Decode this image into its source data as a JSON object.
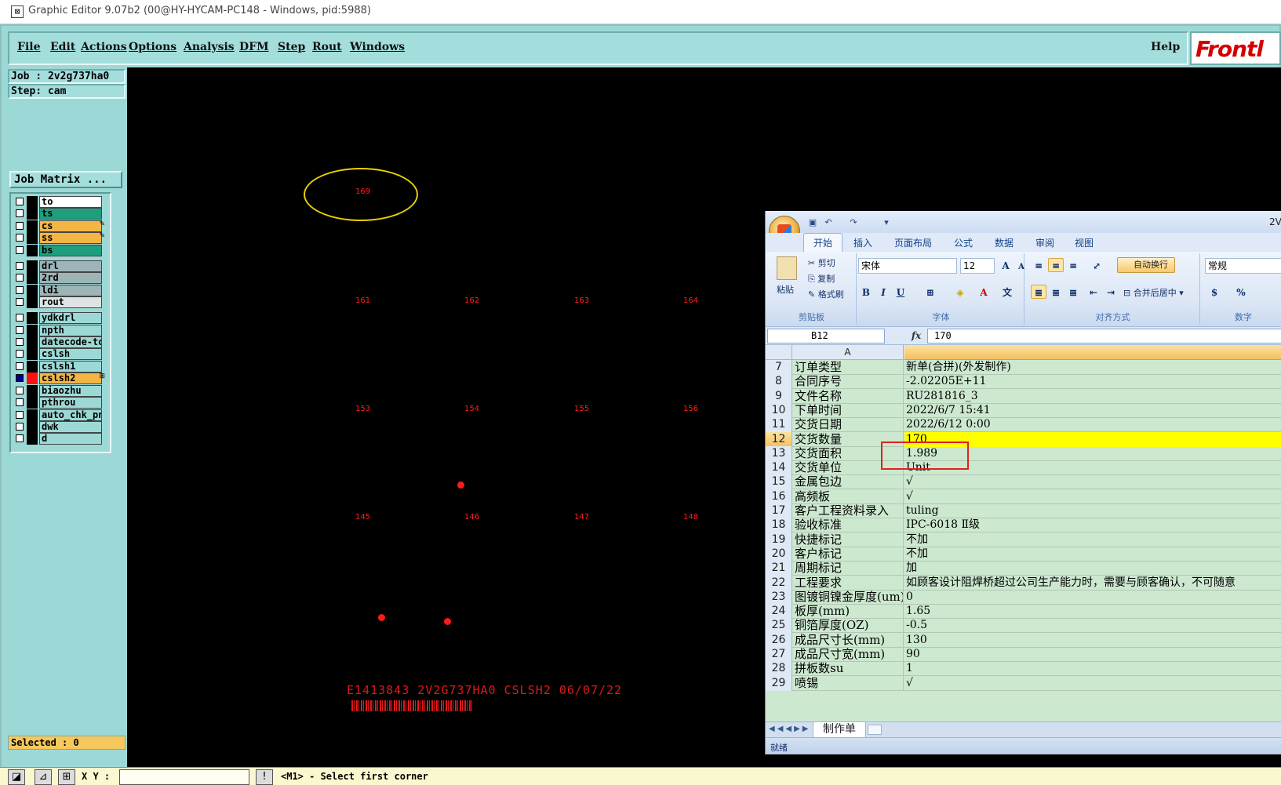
{
  "window": {
    "title": "Graphic Editor 9.07b2 (00@HY-HYCAM-PC148 - Windows, pid:5988)"
  },
  "menubar": {
    "items": [
      "File",
      "Edit",
      "Actions",
      "Options",
      "Analysis",
      "DFM",
      "Step",
      "Rout",
      "Windows"
    ],
    "help": "Help",
    "logo": "Frontl"
  },
  "panel": {
    "job": "Job : 2v2g737ha0",
    "step": "Step: cam",
    "job_matrix": "Job Matrix ...",
    "selected": "Selected : 0"
  },
  "layers": [
    {
      "name": "to",
      "color": "#ffffff",
      "checked": false,
      "active": false
    },
    {
      "name": "ts",
      "color": "#1f9e7e",
      "checked": false,
      "active": false
    },
    {
      "name": "cs",
      "color": "#f5b545",
      "checked": false,
      "active": false,
      "mark": "✎"
    },
    {
      "name": "ss",
      "color": "#f5b545",
      "checked": false,
      "active": false,
      "mark": "✎"
    },
    {
      "name": "bs",
      "color": "#1f9e7e",
      "checked": false,
      "active": false
    },
    {
      "name": "drl",
      "color": "#9eb5b8",
      "checked": false,
      "active": false
    },
    {
      "name": "2rd",
      "color": "#9eb5b8",
      "checked": false,
      "active": false
    },
    {
      "name": "ldi",
      "color": "#9eb5b8",
      "checked": false,
      "active": false
    },
    {
      "name": "rout",
      "color": "#dfe3e3",
      "checked": false,
      "active": false
    },
    {
      "name": "ydkdrl",
      "color": "#9cd9d6",
      "checked": false,
      "active": false
    },
    {
      "name": "npth",
      "color": "#9cd9d6",
      "checked": false,
      "active": false
    },
    {
      "name": "datecode-to",
      "color": "#9cd9d6",
      "checked": false,
      "active": false
    },
    {
      "name": "cslsh",
      "color": "#9cd9d6",
      "checked": false,
      "active": false
    },
    {
      "name": "cslsh1",
      "color": "#9cd9d6",
      "checked": false,
      "active": false
    },
    {
      "name": "cslsh2",
      "color": "#f5b545",
      "checked": true,
      "active": true,
      "mark": "⊞"
    },
    {
      "name": "biaozhu",
      "color": "#9cd9d6",
      "checked": false,
      "active": false
    },
    {
      "name": "pthrou",
      "color": "#9cd9d6",
      "checked": false,
      "active": false
    },
    {
      "name": "auto_chk_pn",
      "color": "#9cd9d6",
      "checked": false,
      "active": false
    },
    {
      "name": "dwk",
      "color": "#9cd9d6",
      "checked": false,
      "active": false
    },
    {
      "name": "d",
      "color": "#9cd9d6",
      "checked": false,
      "active": false
    }
  ],
  "canvas": {
    "step_labels": [
      "169",
      "161",
      "162",
      "163",
      "164",
      "153",
      "154",
      "155",
      "156",
      "145",
      "146",
      "147",
      "148"
    ],
    "bottom_text": "E1413843 2V2G737HA0 CSLSH2 06/07/22"
  },
  "statusbar": {
    "xy_label": "X Y :",
    "xy_value": "",
    "message": "<M1> - Select first corner"
  },
  "excel": {
    "title": "2V",
    "tabs": [
      "开始",
      "插入",
      "页面布局",
      "公式",
      "数据",
      "审阅",
      "视图"
    ],
    "clipboard": {
      "paste": "粘贴",
      "cut": "剪切",
      "copy": "复制",
      "format_painter": "格式刷",
      "label": "剪贴板"
    },
    "font": {
      "name": "宋体",
      "size": "12",
      "label": "字体"
    },
    "align": {
      "wrap": "自动换行",
      "merge": "合并后居中",
      "label": "对齐方式"
    },
    "number": {
      "format": "常规",
      "label": "数字"
    },
    "namebox": "B12",
    "formula": "170",
    "column_a": "A",
    "rows": [
      {
        "n": "7",
        "a": "订单类型",
        "b": "新单(合拼)(外发制作)"
      },
      {
        "n": "8",
        "a": "合同序号",
        "b": "-2.02205E+11"
      },
      {
        "n": "9",
        "a": "文件名称",
        "b": "RU281816_3"
      },
      {
        "n": "10",
        "a": "下单时间",
        "b": "2022/6/7 15:41"
      },
      {
        "n": "11",
        "a": "交货日期",
        "b": "2022/6/12 0:00"
      },
      {
        "n": "12",
        "a": "交货数量",
        "b": "170"
      },
      {
        "n": "13",
        "a": "交货面积",
        "b": "1.989"
      },
      {
        "n": "14",
        "a": "交货单位",
        "b": "Unit"
      },
      {
        "n": "15",
        "a": "金属包边",
        "b": "√"
      },
      {
        "n": "16",
        "a": "高频板",
        "b": "√"
      },
      {
        "n": "17",
        "a": "客户工程资料录入",
        "b": "tuling"
      },
      {
        "n": "18",
        "a": "验收标准",
        "b": "IPC-6018 Ⅱ级"
      },
      {
        "n": "19",
        "a": "快捷标记",
        "b": "不加"
      },
      {
        "n": "20",
        "a": "客户标记",
        "b": "不加"
      },
      {
        "n": "21",
        "a": "周期标记",
        "b": "加"
      },
      {
        "n": "22",
        "a": "工程要求",
        "b": "如顾客设计阻焊桥超过公司生产能力时，需要与顾客确认，不可随意"
      },
      {
        "n": "23",
        "a": "图镀铜镍金厚度(um)",
        "b": "0"
      },
      {
        "n": "24",
        "a": "板厚(mm)",
        "b": "1.65"
      },
      {
        "n": "25",
        "a": "铜箔厚度(OZ)",
        "b": "-0.5"
      },
      {
        "n": "26",
        "a": "成品尺寸长(mm)",
        "b": "130"
      },
      {
        "n": "27",
        "a": "成品尺寸宽(mm)",
        "b": "90"
      },
      {
        "n": "28",
        "a": "拼板数su",
        "b": "1"
      },
      {
        "n": "29",
        "a": "喷锡",
        "b": "√"
      }
    ],
    "current_row": "12",
    "sheet_tab": "制作单",
    "status": "就绪"
  }
}
